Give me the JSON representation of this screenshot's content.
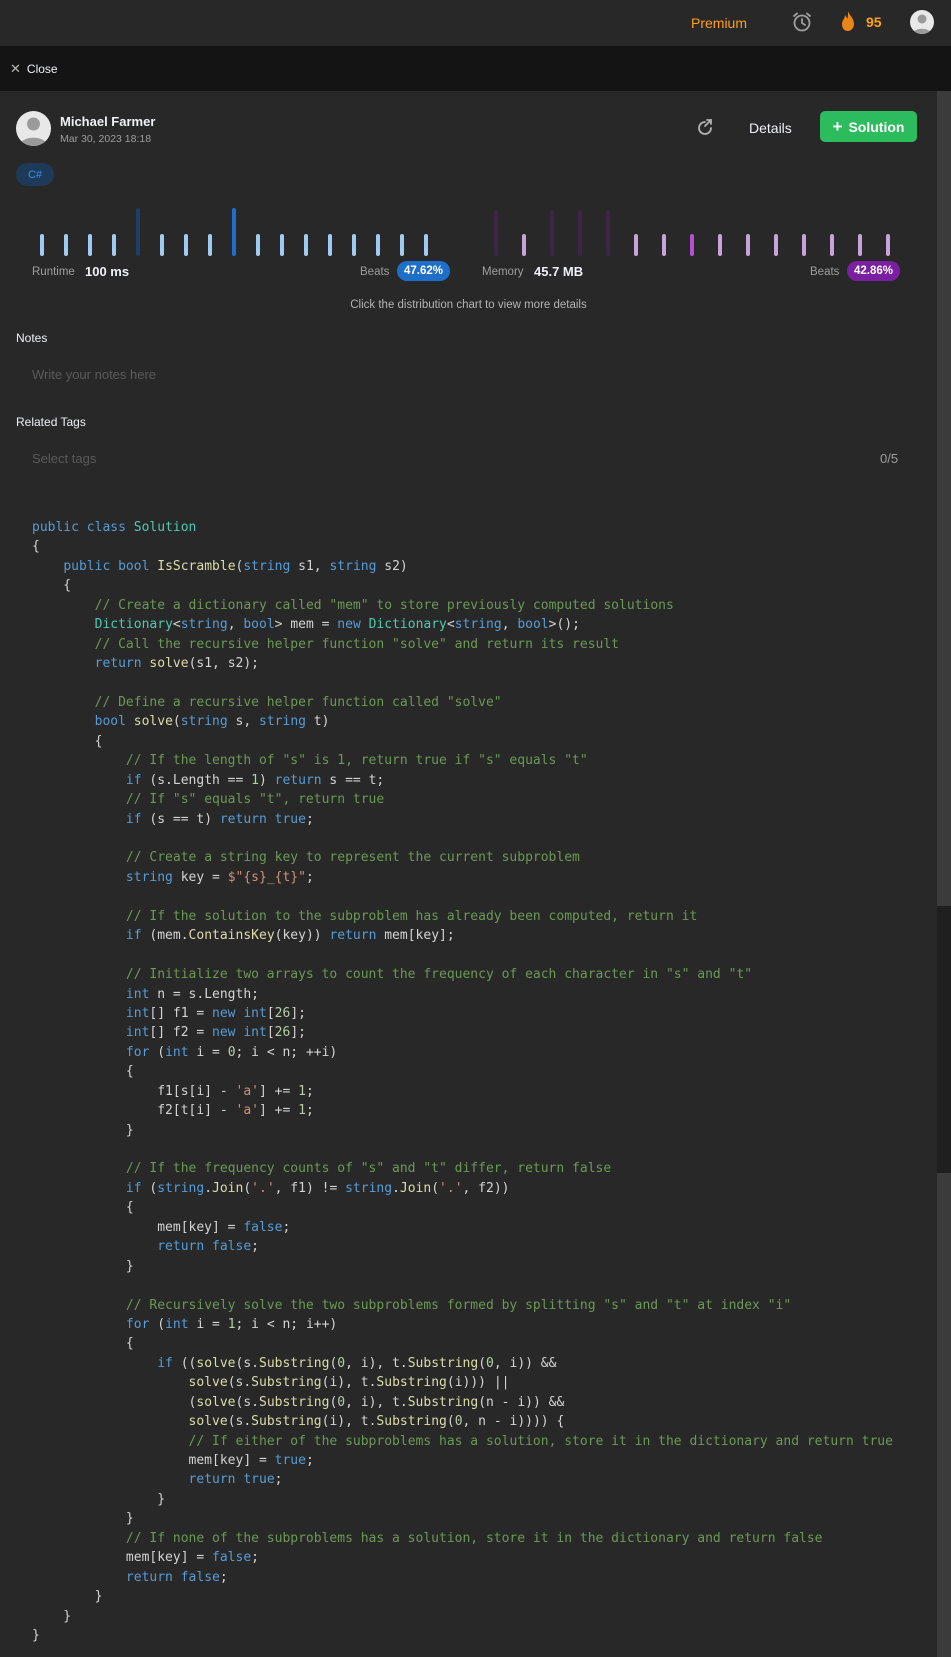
{
  "topbar": {
    "premium_label": "Premium",
    "streak_count": "95"
  },
  "closebar": {
    "close_label": "Close"
  },
  "post": {
    "author": "Michael Farmer",
    "date": "Mar 30, 2023 18:18",
    "details_label": "Details",
    "solution_label": "Solution",
    "language": "C#"
  },
  "performance": {
    "runtime_label": "Runtime",
    "runtime_value": "100 ms",
    "runtime_beats_label": "Beats",
    "runtime_beats_value": "47.62%",
    "memory_label": "Memory",
    "memory_value": "45.7 MB",
    "memory_beats_label": "Beats",
    "memory_beats_value": "42.86%",
    "hint": "Click the distribution chart to view more details",
    "colors": {
      "runtime": "#1e6fc9",
      "memory": "#7b1fa2",
      "runtime_bar": "#9fcbf3",
      "memory_bar": "#c9a1dc"
    }
  },
  "notes": {
    "label": "Notes",
    "placeholder": "Write your notes here"
  },
  "tags": {
    "label": "Related Tags",
    "placeholder": "Select tags",
    "count": "0/5"
  },
  "code_lines": [
    "public class Solution",
    "{",
    "    public bool IsScramble(string s1, string s2)",
    "    {",
    "        // Create a dictionary called \"mem\" to store previously computed solutions",
    "        Dictionary<string, bool> mem = new Dictionary<string, bool>();",
    "        // Call the recursive helper function \"solve\" and return its result",
    "        return solve(s1, s2);",
    "",
    "        // Define a recursive helper function called \"solve\"",
    "        bool solve(string s, string t)",
    "        {",
    "            // If the length of \"s\" is 1, return true if \"s\" equals \"t\"",
    "            if (s.Length == 1) return s == t;",
    "            // If \"s\" equals \"t\", return true",
    "            if (s == t) return true;",
    "",
    "            // Create a string key to represent the current subproblem",
    "            string key = $\"{s}_{t}\";",
    "",
    "            // If the solution to the subproblem has already been computed, return it",
    "            if (mem.ContainsKey(key)) return mem[key];",
    "",
    "            // Initialize two arrays to count the frequency of each character in \"s\" and \"t\"",
    "            int n = s.Length;",
    "            int[] f1 = new int[26];",
    "            int[] f2 = new int[26];",
    "            for (int i = 0; i < n; ++i)",
    "            {",
    "                f1[s[i] - 'a'] += 1;",
    "                f2[t[i] - 'a'] += 1;",
    "            }",
    "",
    "            // If the frequency counts of \"s\" and \"t\" differ, return false",
    "            if (string.Join('.', f1) != string.Join('.', f2))",
    "            {",
    "                mem[key] = false;",
    "                return false;",
    "            }",
    "",
    "            // Recursively solve the two subproblems formed by splitting \"s\" and \"t\" at index \"i\"",
    "            for (int i = 1; i < n; i++)",
    "            {",
    "                if ((solve(s.Substring(0, i), t.Substring(0, i)) &&",
    "                    solve(s.Substring(i), t.Substring(i))) ||",
    "                    (solve(s.Substring(0, i), t.Substring(n - i)) &&",
    "                    solve(s.Substring(i), t.Substring(0, n - i)))) {",
    "                    // If either of the subproblems has a solution, store it in the dictionary and return true",
    "                    mem[key] = true;",
    "                    return true;",
    "                }",
    "            }",
    "            // If none of the subproblems has a solution, store it in the dictionary and return false",
    "            mem[key] = false;",
    "            return false;",
    "        }",
    "    }",
    "}"
  ]
}
